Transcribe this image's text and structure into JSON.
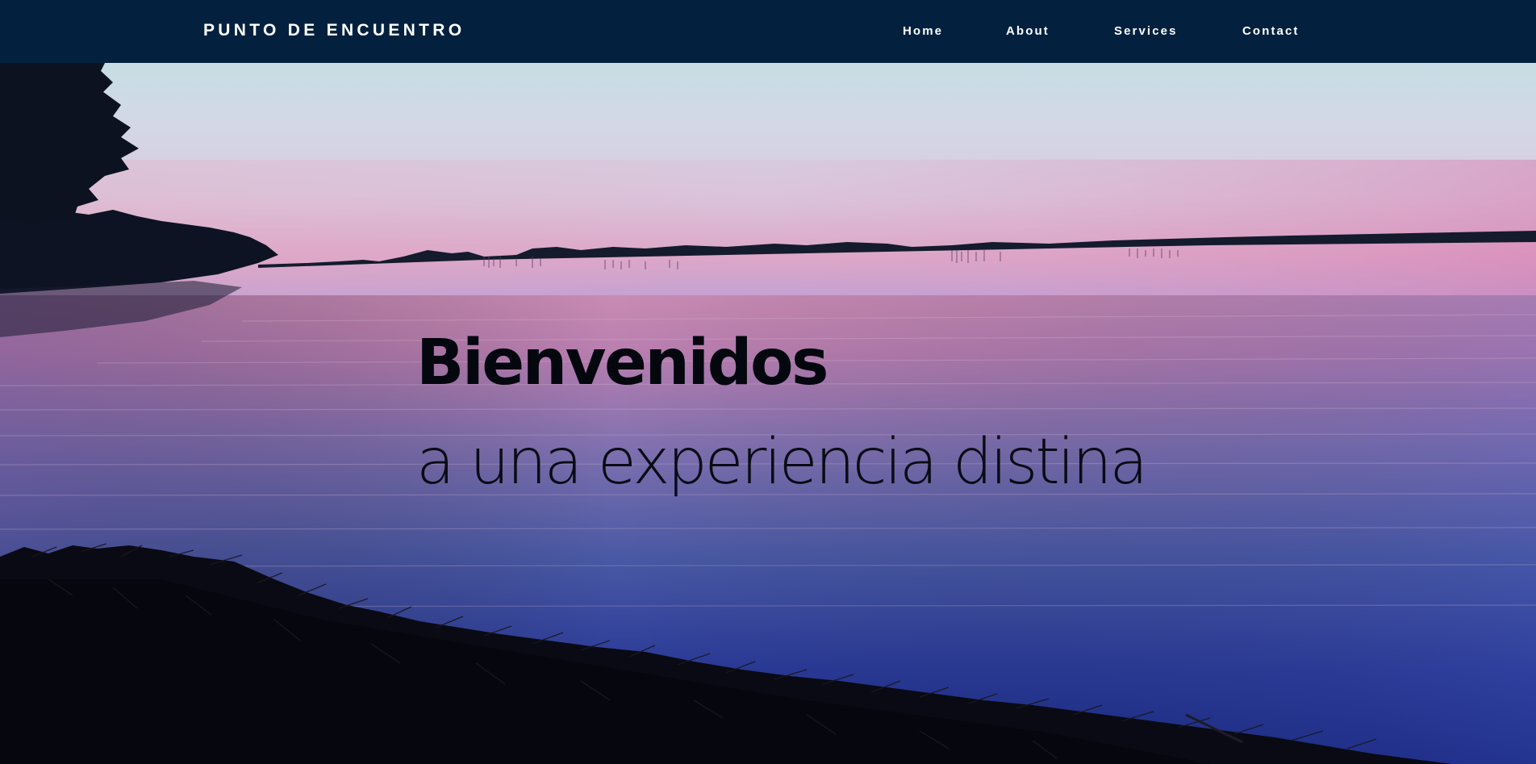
{
  "navbar": {
    "brand": "PUNTO DE ENCUENTRO",
    "links": [
      {
        "label": "Home"
      },
      {
        "label": "About"
      },
      {
        "label": "Services"
      },
      {
        "label": "Contact"
      }
    ]
  },
  "hero": {
    "title": "Bienvenidos",
    "subtitle": "a una experiencia distina"
  },
  "colors": {
    "navbar_bg": "#03213f",
    "nav_text": "#ffffff",
    "hero_text": "#05070e",
    "sky_top": "#cdd8e8",
    "sky_pink": "#dba3c5",
    "water_deep": "#1a2f8c"
  }
}
